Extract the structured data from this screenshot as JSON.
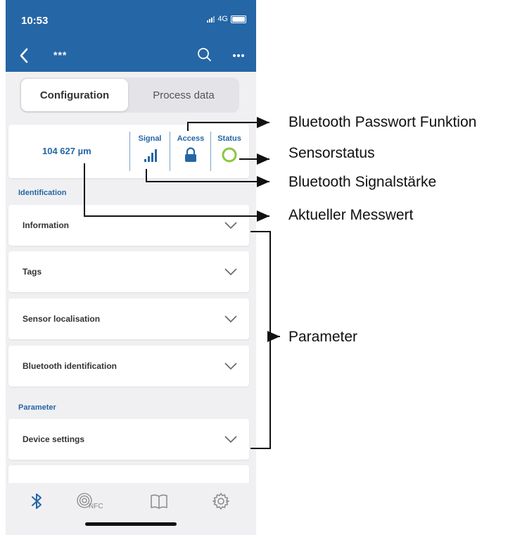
{
  "status_bar": {
    "time": "10:53",
    "network": "4G"
  },
  "nav": {
    "title": "***"
  },
  "segment": {
    "active_label": "Configuration",
    "inactive_label": "Process data"
  },
  "status_card": {
    "measurement": "104 627 µm",
    "signal_label": "Signal",
    "access_label": "Access",
    "status_label": "Status",
    "accent_color": "#2566a6",
    "status_ring_color": "#8dc63f"
  },
  "sections": {
    "identification": "Identification",
    "parameter": "Parameter"
  },
  "rows": [
    {
      "label": "Information"
    },
    {
      "label": "Tags"
    },
    {
      "label": "Sensor localisation"
    },
    {
      "label": "Bluetooth identification"
    },
    {
      "label": "Device settings"
    }
  ],
  "tabbar": {
    "items": [
      {
        "icon": "bluetooth-icon"
      },
      {
        "icon": "nfc-icon",
        "label": "NFC"
      },
      {
        "icon": "book-icon"
      },
      {
        "icon": "gear-icon"
      }
    ]
  },
  "callouts": {
    "password": "Bluetooth Passwort Funktion",
    "sensor_status": "Sensorstatus",
    "signal_strength": "Bluetooth Signalstärke",
    "measurement": "Aktueller Messwert",
    "parameter": "Parameter"
  }
}
